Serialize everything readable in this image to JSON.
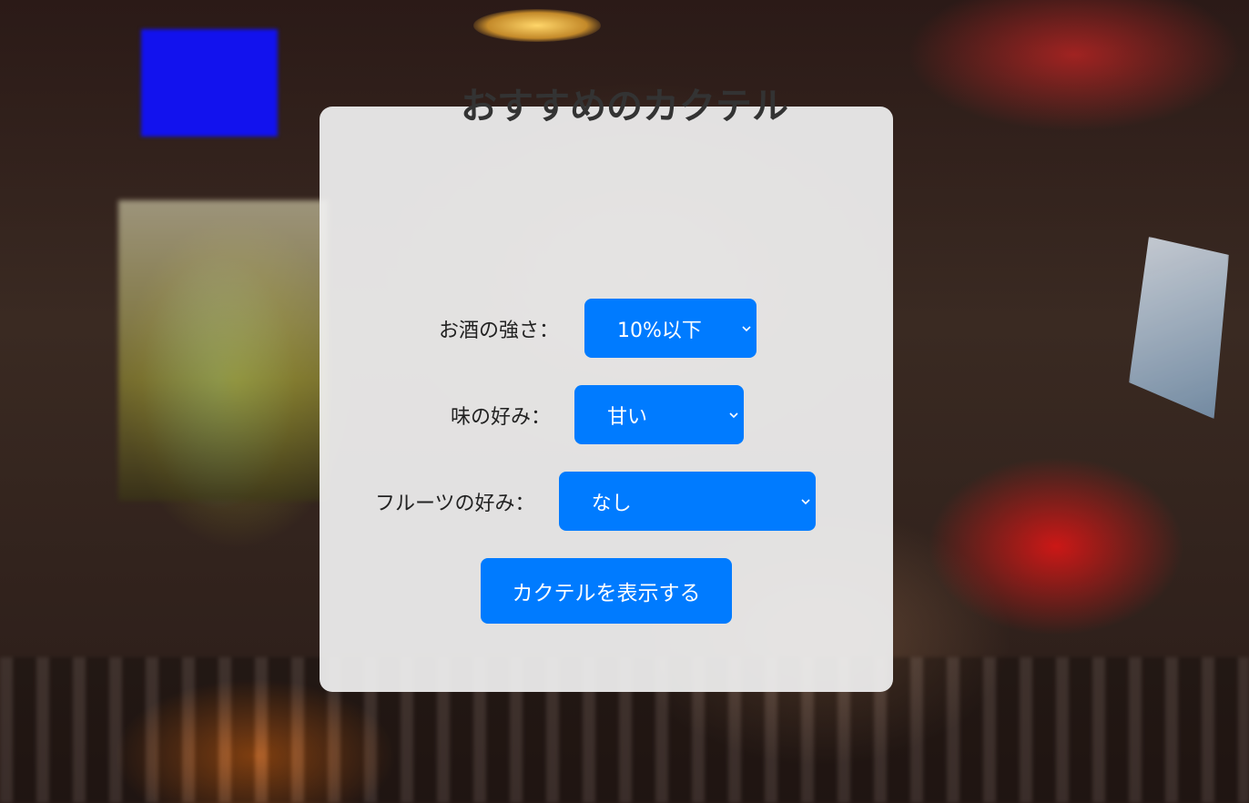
{
  "page": {
    "title": "おすすめのカクテル"
  },
  "form": {
    "strength": {
      "label": "お酒の強さ：",
      "selected": "10%以下"
    },
    "taste": {
      "label": "味の好み：",
      "selected": "甘い"
    },
    "fruit": {
      "label": "フルーツの好み：",
      "selected": "なし"
    },
    "submit_label": "カクテルを表示する"
  },
  "colors": {
    "accent": "#007bff",
    "card_background": "#f0f0f0",
    "title_text": "#333333"
  },
  "icons": {
    "select_arrow": "chevron-down-icon"
  }
}
